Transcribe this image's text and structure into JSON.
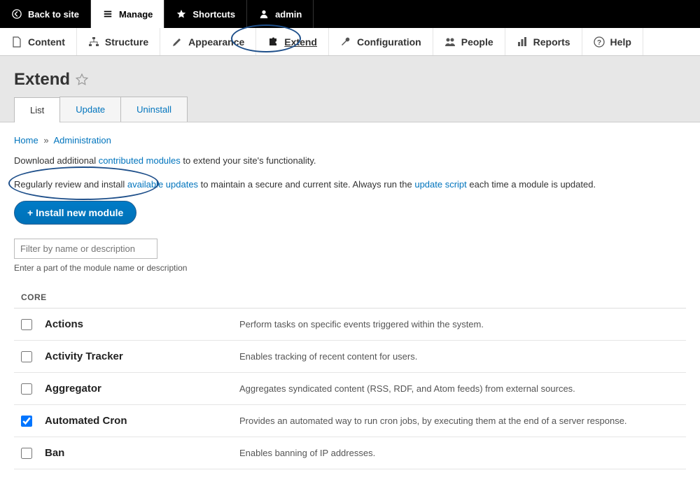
{
  "toolbar": {
    "back": "Back to site",
    "manage": "Manage",
    "shortcuts": "Shortcuts",
    "user": "admin"
  },
  "admin_menu": [
    {
      "id": "content",
      "label": "Content"
    },
    {
      "id": "structure",
      "label": "Structure"
    },
    {
      "id": "appearance",
      "label": "Appearance"
    },
    {
      "id": "extend",
      "label": "Extend",
      "active": true
    },
    {
      "id": "configuration",
      "label": "Configuration"
    },
    {
      "id": "people",
      "label": "People"
    },
    {
      "id": "reports",
      "label": "Reports"
    },
    {
      "id": "help",
      "label": "Help"
    }
  ],
  "page": {
    "title": "Extend"
  },
  "tabs": {
    "list": "List",
    "update": "Update",
    "uninstall": "Uninstall"
  },
  "breadcrumb": {
    "home": "Home",
    "admin": "Administration"
  },
  "desc_line1": {
    "pre": "Download additional ",
    "link": "contributed modules",
    "post": " to extend your site's functionality."
  },
  "desc_line2": {
    "pre": "Regularly review and install ",
    "link1": "available updates",
    "mid": " to maintain a secure and current site. Always run the ",
    "link2": "update script",
    "post": " each time a module is updated."
  },
  "button_install": "+ Install new module",
  "filter_placeholder": "Filter by name or description",
  "filter_help": "Enter a part of the module name or description",
  "module_group": "CORE",
  "modules": [
    {
      "name": "Actions",
      "desc": "Perform tasks on specific events triggered within the system.",
      "checked": false
    },
    {
      "name": "Activity Tracker",
      "desc": "Enables tracking of recent content for users.",
      "checked": false
    },
    {
      "name": "Aggregator",
      "desc": "Aggregates syndicated content (RSS, RDF, and Atom feeds) from external sources.",
      "checked": false
    },
    {
      "name": "Automated Cron",
      "desc": "Provides an automated way to run cron jobs, by executing them at the end of a server response.",
      "checked": true
    },
    {
      "name": "Ban",
      "desc": "Enables banning of IP addresses.",
      "checked": false
    }
  ]
}
